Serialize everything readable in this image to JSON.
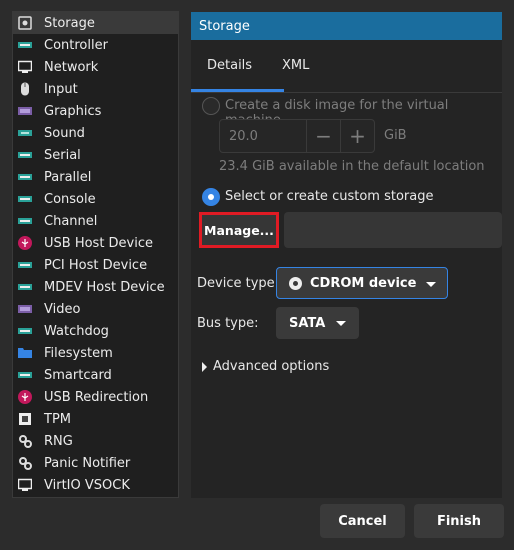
{
  "sidebar": {
    "items": [
      {
        "label": "Storage",
        "icon": "disk-icon",
        "selected": true
      },
      {
        "label": "Controller",
        "icon": "controller-icon"
      },
      {
        "label": "Network",
        "icon": "network-icon"
      },
      {
        "label": "Input",
        "icon": "mouse-icon"
      },
      {
        "label": "Graphics",
        "icon": "graphics-icon"
      },
      {
        "label": "Sound",
        "icon": "sound-icon"
      },
      {
        "label": "Serial",
        "icon": "serial-icon"
      },
      {
        "label": "Parallel",
        "icon": "parallel-icon"
      },
      {
        "label": "Console",
        "icon": "console-icon"
      },
      {
        "label": "Channel",
        "icon": "channel-icon"
      },
      {
        "label": "USB Host Device",
        "icon": "usb-icon"
      },
      {
        "label": "PCI Host Device",
        "icon": "pci-icon"
      },
      {
        "label": "MDEV Host Device",
        "icon": "mdev-icon"
      },
      {
        "label": "Video",
        "icon": "video-icon"
      },
      {
        "label": "Watchdog",
        "icon": "watchdog-icon"
      },
      {
        "label": "Filesystem",
        "icon": "folder-icon"
      },
      {
        "label": "Smartcard",
        "icon": "smartcard-icon"
      },
      {
        "label": "USB Redirection",
        "icon": "usb-redirection-icon"
      },
      {
        "label": "TPM",
        "icon": "tpm-icon"
      },
      {
        "label": "RNG",
        "icon": "rng-gear-icon"
      },
      {
        "label": "Panic Notifier",
        "icon": "panic-gear-icon"
      },
      {
        "label": "VirtIO VSOCK",
        "icon": "vsock-icon"
      }
    ]
  },
  "header": {
    "title": "Storage"
  },
  "tabs": {
    "details": "Details",
    "xml": "XML"
  },
  "storage": {
    "create_image_label": "Create a disk image for the virtual machine",
    "size_value": "20.0",
    "size_unit": "GiB",
    "available_text": "23.4 GiB available in the default location",
    "custom_label": "Select or create custom storage",
    "manage_label": "Manage...",
    "path_value": ""
  },
  "device_type": {
    "label": "Device type:",
    "value": "CDROM device",
    "icon": "cdrom-icon"
  },
  "bus_type": {
    "label": "Bus type:",
    "value": "SATA"
  },
  "advanced": {
    "label": "Advanced options"
  },
  "footer": {
    "cancel": "Cancel",
    "finish": "Finish"
  },
  "colors": {
    "accent": "#3584e4",
    "header_bg": "#1a6d9e",
    "highlight_border": "#e01b24"
  }
}
